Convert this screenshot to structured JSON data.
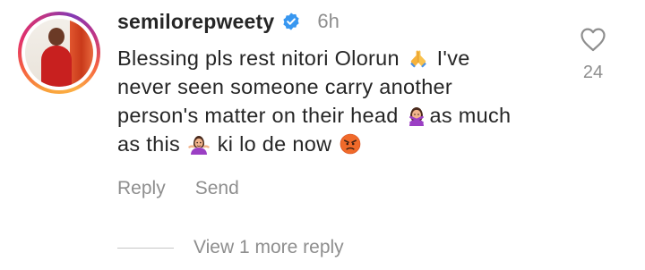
{
  "comment": {
    "username": "semilorepweety",
    "time": "6h",
    "text": {
      "segment_1": "Blessing pls rest nitori Olorun ",
      "segment_2": " I've never seen someone carry another person's matter on their head ",
      "segment_3": "as much as this ",
      "segment_4": " ki lo de now "
    },
    "emojis": [
      "folded-hands",
      "person-gesturing-no",
      "person-shrugging",
      "angry-face"
    ],
    "like_count": "24",
    "actions": {
      "reply": "Reply",
      "send": "Send"
    },
    "view_replies": "View 1 more reply"
  },
  "colors": {
    "text": "#262626",
    "muted": "#8e8e8e",
    "verified_blue": "#3897f0",
    "divider": "#c7c7c7"
  },
  "icons": {
    "verified": "verified-badge-icon",
    "like": "heart-outline-icon"
  }
}
